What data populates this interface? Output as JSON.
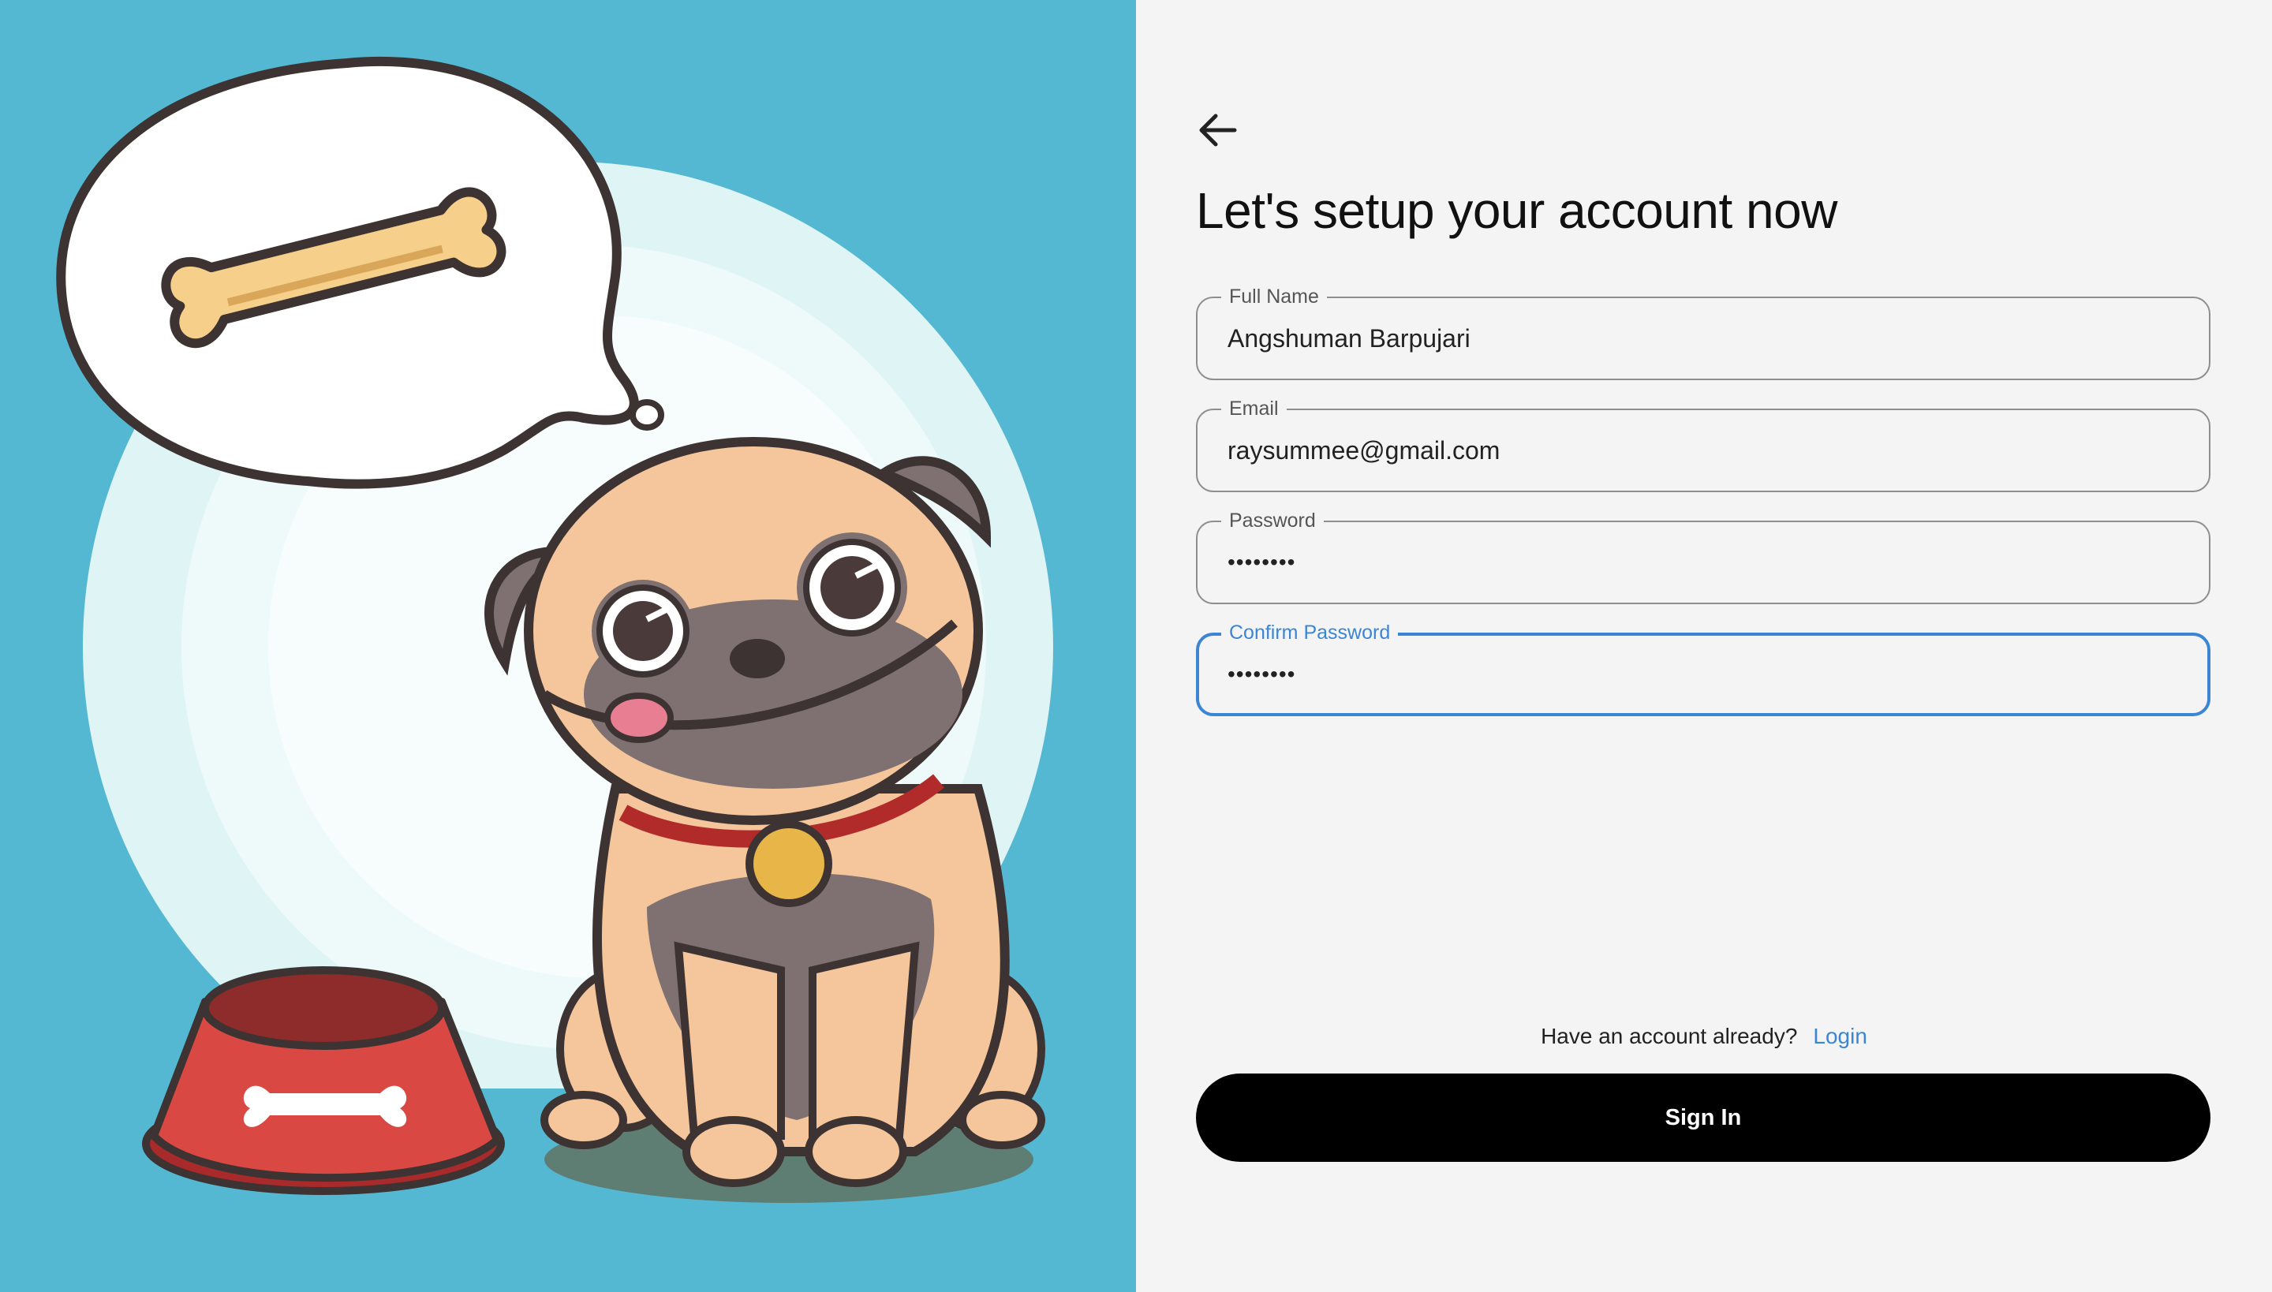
{
  "illustration": {
    "background_color": "#55b8d3",
    "subject": "pug-dog-icon",
    "thought_subject": "bone-icon",
    "bowl": "dog-bowl-icon"
  },
  "form": {
    "back_icon": "arrow-left-icon",
    "title": "Let's setup your account now",
    "fields": {
      "full_name": {
        "label": "Full Name",
        "value": "Angshuman Barpujari"
      },
      "email": {
        "label": "Email",
        "value": "raysummee@gmail.com"
      },
      "password": {
        "label": "Password",
        "value": "••••••••"
      },
      "confirm_password": {
        "label": "Confirm Password",
        "value": "••••••••"
      }
    },
    "focus_color": "#3b86d4",
    "login_prompt": "Have an account already?",
    "login_link": "Login",
    "submit_label": "Sign In"
  }
}
